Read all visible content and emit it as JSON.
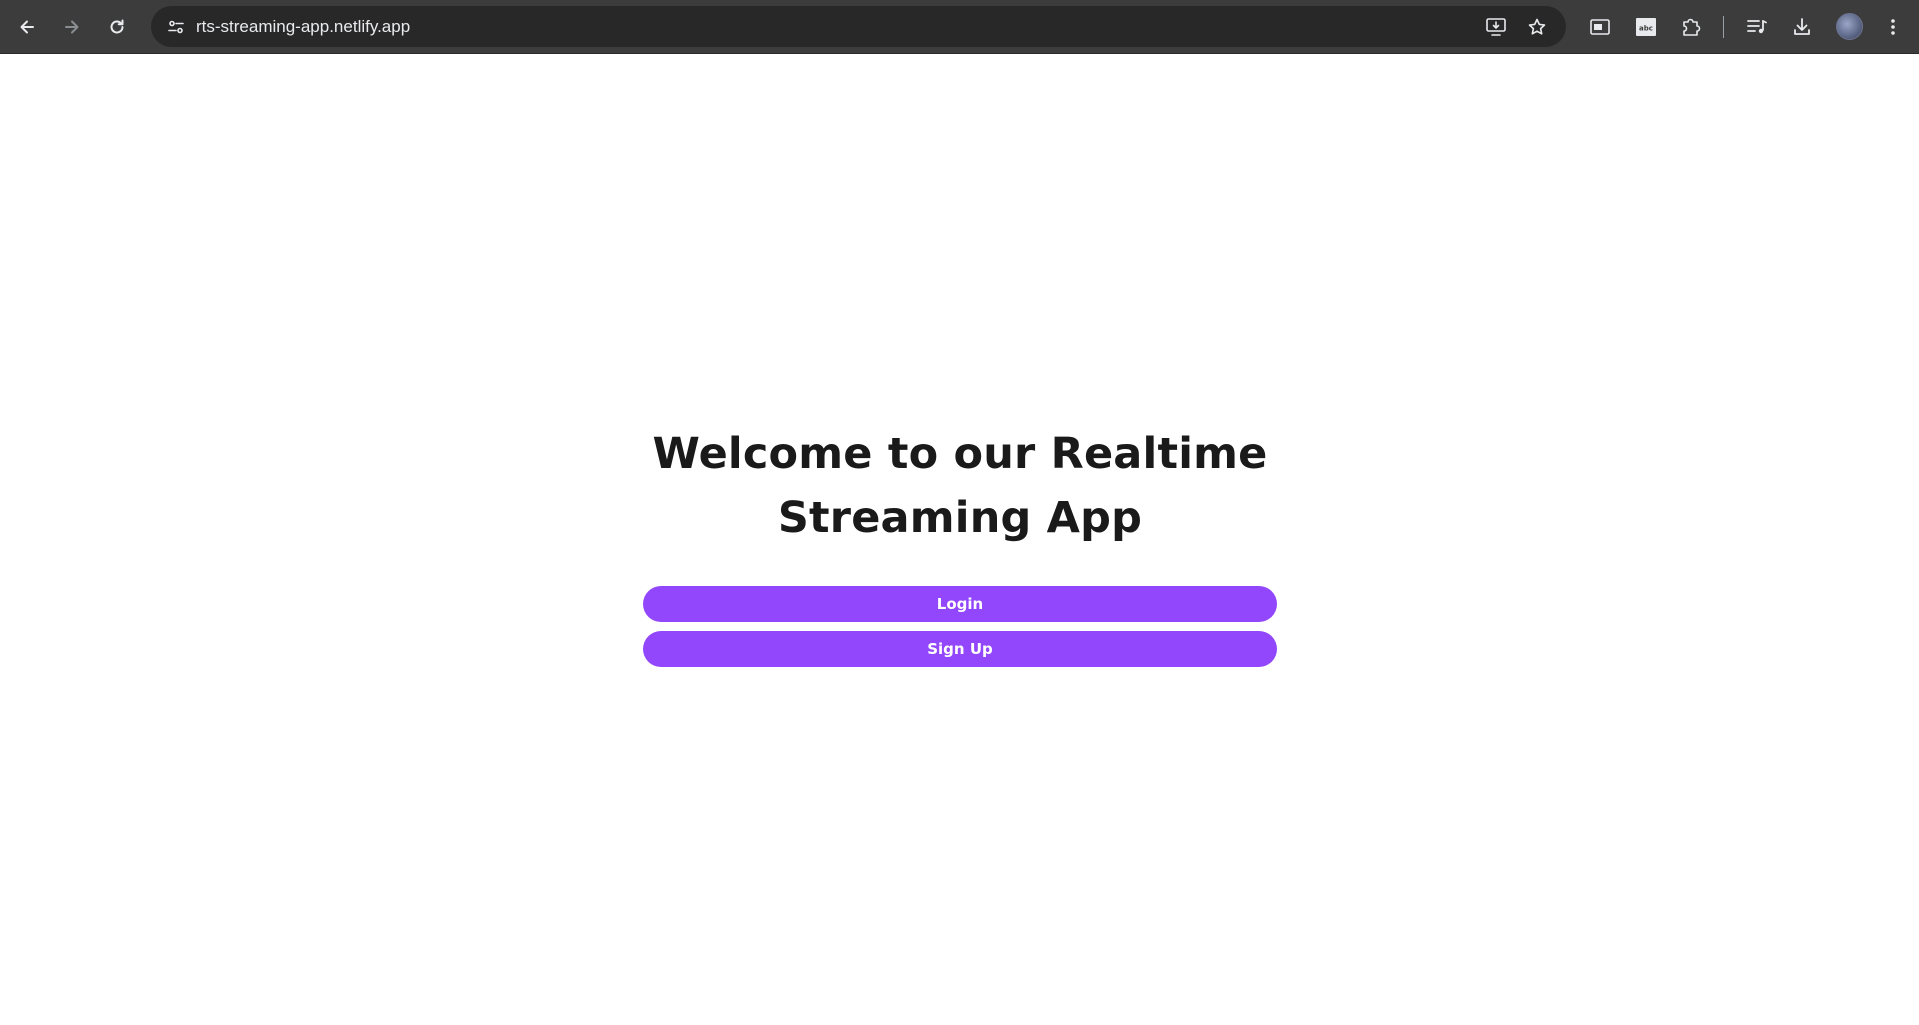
{
  "browser": {
    "url": "rts-streaming-app.netlify.app",
    "icons": {
      "back": "back-arrow-icon",
      "forward": "forward-arrow-icon",
      "reload": "reload-icon",
      "site_info": "site-info-icon",
      "install": "install-app-icon",
      "bookmark": "star-icon",
      "picture_in_picture": "picture-in-picture-icon",
      "extension_abc": "extension-icon",
      "extensions": "puzzle-icon",
      "media": "media-controls-icon",
      "downloads": "download-icon",
      "profile": "profile-avatar",
      "menu": "kebab-menu-icon"
    }
  },
  "page": {
    "heading_line1": "Welcome to our Realtime",
    "heading_line2": "Streaming App",
    "login_label": "Login",
    "signup_label": "Sign Up",
    "accent_color": "#9247fc"
  }
}
